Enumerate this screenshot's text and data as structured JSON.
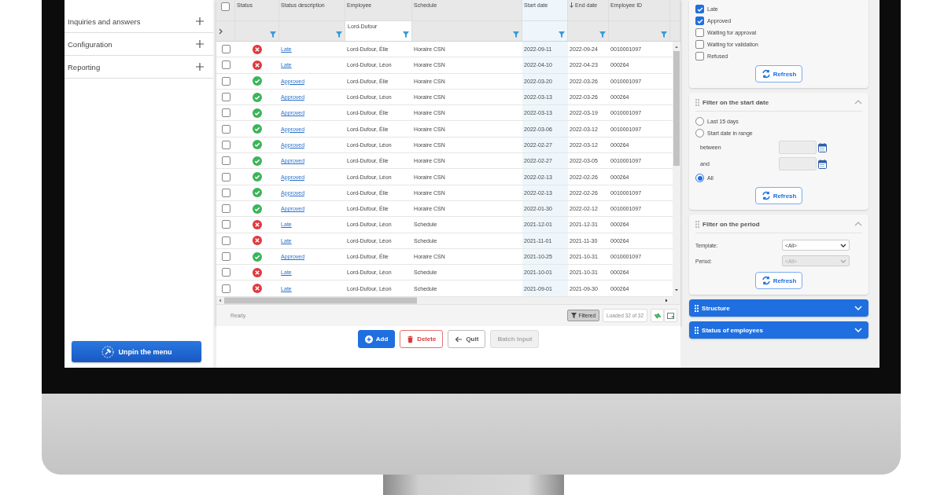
{
  "sidebar": {
    "items": [
      {
        "label": "Inquiries and answers",
        "expanded": false
      },
      {
        "label": "Configuration",
        "expanded": false
      },
      {
        "label": "Reporting",
        "expanded": false
      }
    ],
    "unpin_button": "Unpin the menu"
  },
  "grid": {
    "header_checkbox": {
      "checked": false
    },
    "columns": [
      {
        "label": "Status",
        "sorted": false,
        "highlighted": false
      },
      {
        "label": "Status description",
        "sorted": false,
        "highlighted": false
      },
      {
        "label": "Employee",
        "sorted": false,
        "highlighted": false,
        "filter": "Lord-Dufour"
      },
      {
        "label": "Schedule",
        "sorted": false,
        "highlighted": false
      },
      {
        "label": "Start date",
        "sorted": false,
        "highlighted": true
      },
      {
        "label": "End date",
        "sorted": true,
        "highlighted": false
      },
      {
        "label": "Employee ID",
        "sorted": false,
        "highlighted": false
      }
    ],
    "rows": [
      {
        "checked": false,
        "kind": "late",
        "description": "Late",
        "employee": "Lord-Dufour, Élie",
        "schedule": "Horaire CSN",
        "start": "2022-09-11",
        "end": "2022-09-24",
        "employee_id": "0010001097"
      },
      {
        "checked": false,
        "kind": "late",
        "description": "Late",
        "employee": "Lord-Dufour, Léon",
        "schedule": "Horaire CSN",
        "start": "2022-04-10",
        "end": "2022-04-23",
        "employee_id": "000264"
      },
      {
        "checked": false,
        "kind": "approved",
        "description": "Approved",
        "employee": "Lord-Dufour, Élie",
        "schedule": "Horaire CSN",
        "start": "2022-03-20",
        "end": "2022-03-26",
        "employee_id": "0010001097"
      },
      {
        "checked": false,
        "kind": "approved",
        "description": "Approved",
        "employee": "Lord-Dufour, Léon",
        "schedule": "Horaire CSN",
        "start": "2022-03-13",
        "end": "2022-03-26",
        "employee_id": "000264"
      },
      {
        "checked": false,
        "kind": "approved",
        "description": "Approved",
        "employee": "Lord-Dufour, Élie",
        "schedule": "Horaire CSN",
        "start": "2022-03-13",
        "end": "2022-03-19",
        "employee_id": "0010001097"
      },
      {
        "checked": false,
        "kind": "approved",
        "description": "Approved",
        "employee": "Lord-Dufour, Élie",
        "schedule": "Horaire CSN",
        "start": "2022-03-06",
        "end": "2022-03-12",
        "employee_id": "0010001097"
      },
      {
        "checked": false,
        "kind": "approved",
        "description": "Approved",
        "employee": "Lord-Dufour, Léon",
        "schedule": "Horaire CSN",
        "start": "2022-02-27",
        "end": "2022-03-12",
        "employee_id": "000264"
      },
      {
        "checked": false,
        "kind": "approved",
        "description": "Approved",
        "employee": "Lord-Dufour, Élie",
        "schedule": "Horaire CSN",
        "start": "2022-02-27",
        "end": "2022-03-05",
        "employee_id": "0010001097"
      },
      {
        "checked": false,
        "kind": "approved",
        "description": "Approved",
        "employee": "Lord-Dufour, Léon",
        "schedule": "Horaire CSN",
        "start": "2022-02-13",
        "end": "2022-02-26",
        "employee_id": "000264"
      },
      {
        "checked": false,
        "kind": "approved",
        "description": "Approved",
        "employee": "Lord-Dufour, Élie",
        "schedule": "Horaire CSN",
        "start": "2022-02-13",
        "end": "2022-02-26",
        "employee_id": "0010001097"
      },
      {
        "checked": false,
        "kind": "approved",
        "description": "Approved",
        "employee": "Lord-Dufour, Élie",
        "schedule": "Horaire CSN",
        "start": "2022-01-30",
        "end": "2022-02-12",
        "employee_id": "0010001097"
      },
      {
        "checked": false,
        "kind": "late",
        "description": "Late",
        "employee": "Lord-Dufour, Léon",
        "schedule": "Schedule",
        "start": "2021-12-01",
        "end": "2021-12-31",
        "employee_id": "000264"
      },
      {
        "checked": false,
        "kind": "late",
        "description": "Late",
        "employee": "Lord-Dufour, Léon",
        "schedule": "Schedule",
        "start": "2021-11-01",
        "end": "2021-11-30",
        "employee_id": "000264"
      },
      {
        "checked": false,
        "kind": "approved",
        "description": "Approved",
        "employee": "Lord-Dufour, Élie",
        "schedule": "Horaire CSN",
        "start": "2021-10-25",
        "end": "2021-10-31",
        "employee_id": "0010001097"
      },
      {
        "checked": false,
        "kind": "late",
        "description": "Late",
        "employee": "Lord-Dufour, Léon",
        "schedule": "Schedule",
        "start": "2021-10-01",
        "end": "2021-10-31",
        "employee_id": "000264"
      },
      {
        "checked": false,
        "kind": "late",
        "description": "Late",
        "employee": "Lord-Dufour, Léon",
        "schedule": "Schedule",
        "start": "2021-09-01",
        "end": "2021-09-30",
        "employee_id": "000264"
      }
    ],
    "status_text": "Ready.",
    "filtered_button": {
      "label": "Filtered",
      "pressed": true
    },
    "loaded": "Loaded 32 of 32"
  },
  "actions": [
    {
      "label": "Add",
      "kind": "primary"
    },
    {
      "label": "Delete",
      "kind": "danger"
    },
    {
      "label": "Quit",
      "kind": "back"
    },
    {
      "label": "Batch input",
      "kind": "disabled"
    }
  ],
  "status_filter": {
    "options": [
      {
        "label": "Late",
        "checked": true
      },
      {
        "label": "Approved",
        "checked": true
      },
      {
        "label": "Waiting for approval",
        "checked": false
      },
      {
        "label": "Waiting for validation",
        "checked": false
      },
      {
        "label": "Refused",
        "checked": false
      }
    ],
    "refresh": "Refresh"
  },
  "start_date_filter": {
    "title": "Filter on the start date",
    "expanded": true,
    "options": [
      {
        "label": "Last 15 days",
        "selected": false
      },
      {
        "label": "Start date in range",
        "selected": false
      },
      {
        "label": "All",
        "selected": true
      }
    ],
    "between_label": "between",
    "and_label": "and",
    "refresh": "Refresh"
  },
  "period_filter": {
    "title": "Filter on the period",
    "expanded": true,
    "template_label": "Template:",
    "template_value": "<All>",
    "period_label": "Period:",
    "period_value": "<All>",
    "period_disabled": true,
    "refresh": "Refresh"
  },
  "sections": [
    {
      "title": "Structure",
      "expanded": false
    },
    {
      "title": "Status of employees",
      "expanded": false
    }
  ]
}
